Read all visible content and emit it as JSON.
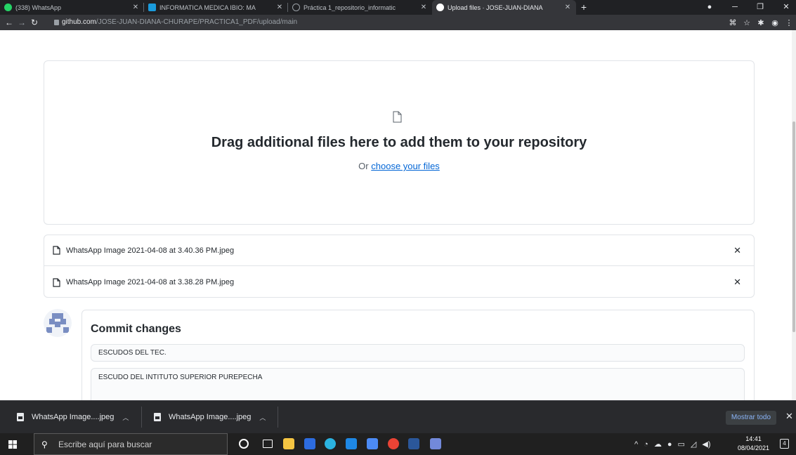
{
  "browser": {
    "tabs": [
      {
        "title": "(338) WhatsApp",
        "color": "#25d366"
      },
      {
        "title": "INFORMATICA MEDICA IBIO: MA",
        "color": "#1a9bdc"
      },
      {
        "title": "Práctica 1_repositorio_informatic",
        "color": "#9aa0a6"
      },
      {
        "title": "Upload files · JOSE-JUAN-DIANA",
        "color": "#ffffff"
      }
    ],
    "url_host": "github.com",
    "url_path": "/JOSE-JUAN-DIANA-CHURAPE/PRACTICA1_PDF/upload/main"
  },
  "upload": {
    "heading": "Drag additional files here to add them to your repository",
    "or_text": "Or",
    "choose_link": "choose your files"
  },
  "files": [
    {
      "name": "WhatsApp Image 2021-04-08 at 3.40.36 PM.jpeg"
    },
    {
      "name": "WhatsApp Image 2021-04-08 at 3.38.28 PM.jpeg"
    }
  ],
  "commit": {
    "title": "Commit changes",
    "summary_value": "ESCUDOS DEL TEC.",
    "description_value": "ESCUDO DEL INTITUTO SUPERIOR PUREPECHA"
  },
  "downloads": {
    "items": [
      {
        "name": "WhatsApp Image....jpeg"
      },
      {
        "name": "WhatsApp Image....jpeg"
      }
    ],
    "show_all": "Mostrar todo"
  },
  "taskbar": {
    "search_placeholder": "Escribe aquí para buscar",
    "time": "14:41",
    "date": "08/04/2021",
    "notifications": "4"
  },
  "colors": {
    "link": "#0366d6",
    "browser_frame": "#202124",
    "border": "#e1e4e8"
  }
}
